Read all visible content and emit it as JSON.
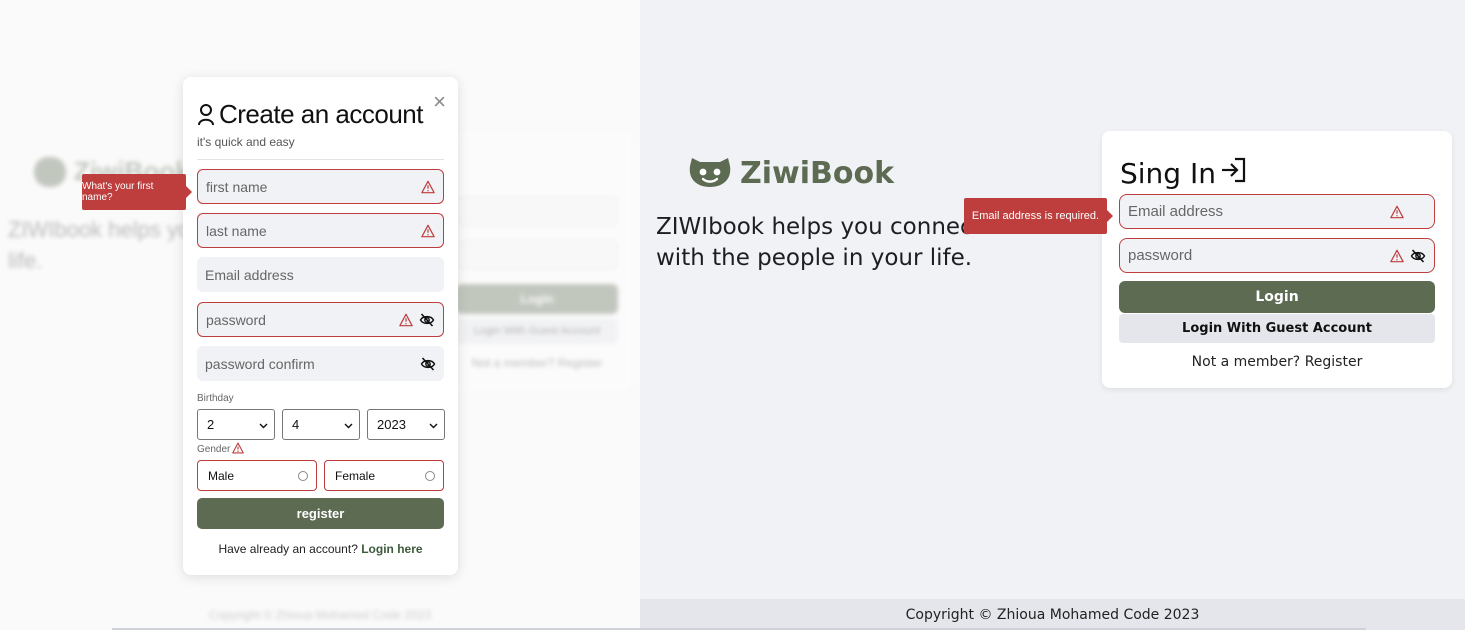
{
  "background_page": {
    "brand_name": "ZiwiBook",
    "tagline": "ZIWIbook helps you connect and share with the people in your life.",
    "login_label": "Login",
    "guest_label": "Login With Guest Account",
    "register_prompt": "Not a member? Register",
    "copyright": "Copyright © Zhioua Mohamed Code 2023"
  },
  "register_modal": {
    "title": "Create an account",
    "subtitle": "it's quick and easy",
    "close_glyph": "×",
    "first_name_placeholder": "first name",
    "last_name_placeholder": "last name",
    "email_placeholder": "Email address",
    "password_placeholder": "password",
    "password_confirm_placeholder": "password confirm",
    "birthday_label": "Birthday",
    "birthday": {
      "day": "2",
      "month": "4",
      "year": "2023"
    },
    "gender_label": "Gender",
    "gender_options": [
      "Male",
      "Female"
    ],
    "register_label": "register",
    "have_account_text": "Have already an account?",
    "login_link": "Login here",
    "first_name_error": "What's your first name?"
  },
  "login_page": {
    "brand_name": "ZiwiBook",
    "tagline_line1": "ZIWIbook helps you connect and share",
    "tagline_line2": "with the people in your life.",
    "sign_in_title": "Sing In",
    "email_placeholder": "Email address",
    "password_placeholder": "password",
    "email_error": "Email address is required.",
    "login_label": "Login",
    "guest_label": "Login With Guest Account",
    "register_prompt": "Not a member? Register",
    "copyright": "Copyright © Zhioua Mohamed Code 2023"
  },
  "icons": {
    "warning": "warning-icon",
    "eye_slash": "eye-slash-icon",
    "user": "user-icon",
    "sign_in": "sign-in-icon",
    "logo": "ziwibook-logo-icon"
  },
  "colors": {
    "brand": "#5c6b52",
    "error": "#be3d3d",
    "page_bg": "#f0f2f5"
  }
}
